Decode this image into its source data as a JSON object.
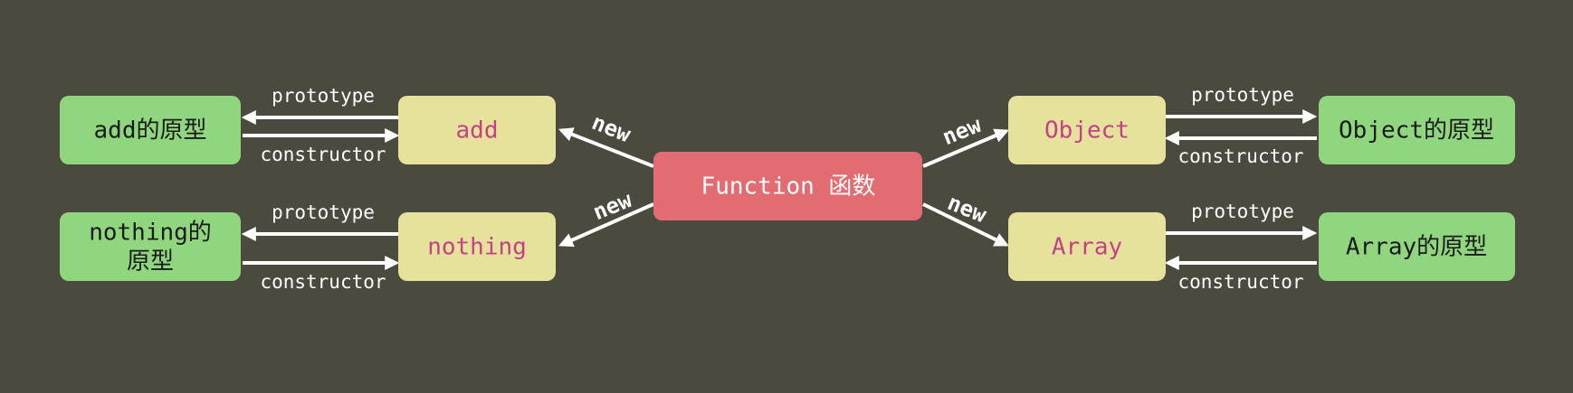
{
  "diagram": {
    "colors": {
      "background": "#4b4a3f",
      "center_fill": "#e36b72",
      "center_text": "#ffffff",
      "instance_fill": "#e6e19b",
      "instance_text": "#c4418a",
      "prototype_fill": "#8fd67e",
      "prototype_text": "#1a1a1a",
      "edge": "#ffffff"
    },
    "center": {
      "label": "Function 函数"
    },
    "nodes": {
      "add": {
        "label": "add"
      },
      "nothing": {
        "label": "nothing"
      },
      "object": {
        "label": "Object"
      },
      "array": {
        "label": "Array"
      },
      "add_proto": {
        "label": "add的原型"
      },
      "nothing_proto_line1": {
        "label": "nothing的"
      },
      "nothing_proto_line2": {
        "label": "原型"
      },
      "object_proto": {
        "label": "Object的原型"
      },
      "array_proto": {
        "label": "Array的原型"
      }
    },
    "edges": {
      "prototype": "prototype",
      "constructor": "constructor",
      "new": "new"
    }
  }
}
